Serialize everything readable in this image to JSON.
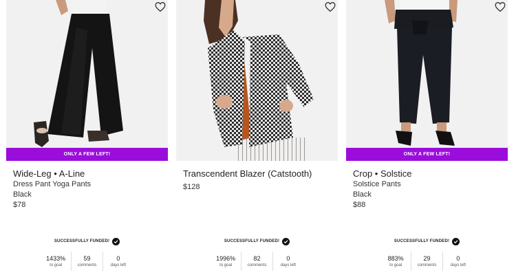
{
  "products": [
    {
      "banner": "ONLY A FEW LEFT!",
      "title": "Wide-Leg • A-Line",
      "line1": "Dress Pant Yoga Pants",
      "line2": "Black",
      "price": "$78",
      "funded_label": "SUCCESSFULLY FUNDED!",
      "stats": [
        {
          "value": "1433%",
          "label": "to goal"
        },
        {
          "value": "59",
          "label": "comments"
        },
        {
          "value": "0",
          "label": "days left"
        }
      ]
    },
    {
      "banner": "",
      "title": "Transcendent Blazer (Catstooth)",
      "line1": "",
      "line2": "",
      "price": "$128",
      "funded_label": "SUCCESSFULLY FUNDED!",
      "stats": [
        {
          "value": "1996%",
          "label": "to goal"
        },
        {
          "value": "82",
          "label": "comments"
        },
        {
          "value": "0",
          "label": "days left"
        }
      ]
    },
    {
      "banner": "ONLY A FEW LEFT!",
      "title": "Crop • Solstice",
      "line1": "Solstice Pants",
      "line2": "Black",
      "price": "$88",
      "funded_label": "SUCCESSFULLY FUNDED!",
      "stats": [
        {
          "value": "883%",
          "label": "to goal"
        },
        {
          "value": "29",
          "label": "comments"
        },
        {
          "value": "0",
          "label": "days left"
        }
      ]
    }
  ],
  "colors": {
    "banner": "#9b0ddb",
    "photo_bg": "#f1f1f1"
  }
}
